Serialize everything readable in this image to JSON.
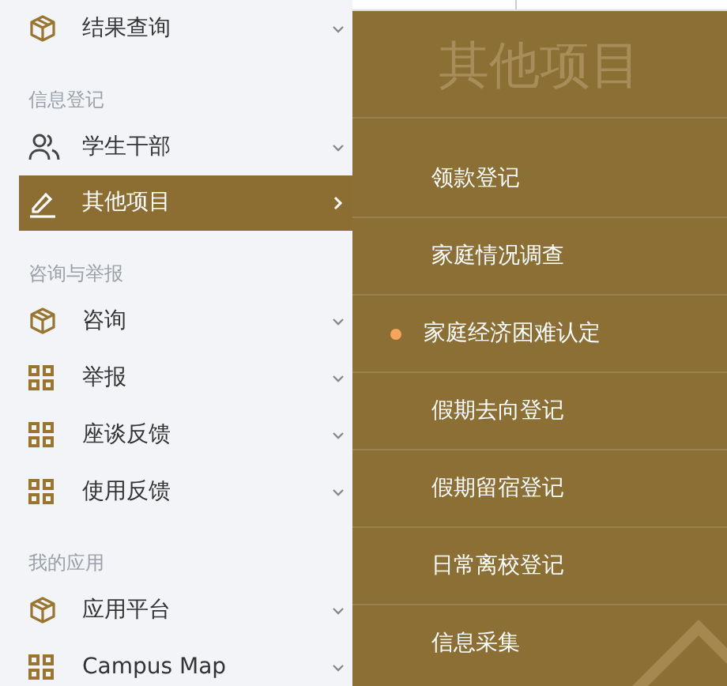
{
  "sidebar": {
    "sections": [
      {
        "items": [
          {
            "label": "结果查询",
            "kind": "box",
            "selected": false
          }
        ]
      },
      {
        "heading": "信息登记",
        "items": [
          {
            "label": "学生干部",
            "kind": "people",
            "selected": false
          },
          {
            "label": "其他项目",
            "kind": "pencil",
            "selected": true
          }
        ]
      },
      {
        "heading": "咨询与举报",
        "items": [
          {
            "label": "咨询",
            "kind": "box",
            "selected": false
          },
          {
            "label": "举报",
            "kind": "grid",
            "selected": false
          },
          {
            "label": "座谈反馈",
            "kind": "grid",
            "selected": false
          },
          {
            "label": "使用反馈",
            "kind": "grid",
            "selected": false
          }
        ]
      },
      {
        "heading": "我的应用",
        "items": [
          {
            "label": "应用平台",
            "kind": "box",
            "selected": false
          },
          {
            "label": "Campus Map",
            "kind": "grid",
            "selected": false
          }
        ]
      }
    ]
  },
  "flyout": {
    "title": "其他项目",
    "items": [
      {
        "label": "领款登记",
        "selected": false
      },
      {
        "label": "家庭情况调查",
        "selected": false
      },
      {
        "label": "家庭经济困难认定",
        "selected": true
      },
      {
        "label": "假期去向登记",
        "selected": false
      },
      {
        "label": "假期留宿登记",
        "selected": false
      },
      {
        "label": "日常离校登记",
        "selected": false
      },
      {
        "label": "信息采集",
        "selected": false
      }
    ]
  }
}
